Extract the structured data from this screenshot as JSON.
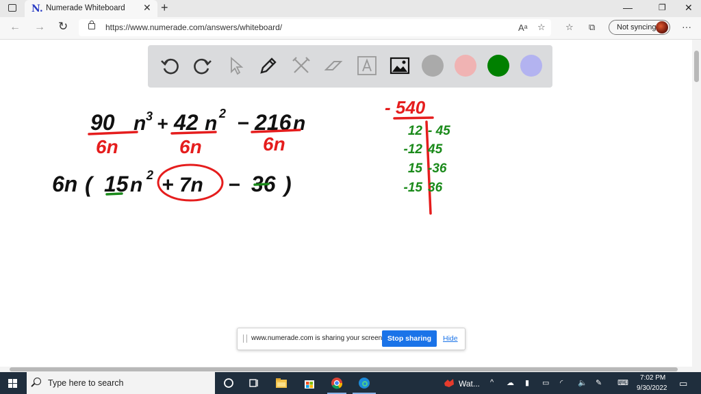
{
  "browser": {
    "tab_title": "Numerade Whiteboard",
    "tab_favicon": "N.",
    "url": "https://www.numerade.com/answers/whiteboard/",
    "sync_label": "Not syncing"
  },
  "toolbar": {
    "tools": [
      "undo-icon",
      "redo-icon",
      "pointer-icon",
      "pen-icon",
      "tools-icon",
      "eraser-icon",
      "text-icon",
      "image-icon"
    ],
    "colors": [
      "#aaaaaa",
      "#f0b3b3",
      "#008000",
      "#b3b3f0"
    ]
  },
  "whiteboard": {
    "ink_colors": {
      "black": "#111111",
      "red": "#e51d1d",
      "green": "#1a8a1a"
    },
    "row1": {
      "t1_num": "90",
      "t1_var": "n",
      "t1_exp": "3",
      "op1": "+",
      "t2_num": "42",
      "t2_var": "n",
      "t2_exp": "2",
      "op2": "−",
      "t3_num": "216",
      "t3_var": "n",
      "den": "6n"
    },
    "row2": {
      "factor": "6n",
      "open": "(",
      "a": "15",
      "var": "n",
      "exp": "2",
      "mid": "+ 7n",
      "op": "−",
      "c": "36",
      "close": ")"
    },
    "table": {
      "head": "- 540",
      "left": [
        "12",
        "-12",
        "15",
        "-15"
      ],
      "right": [
        "- 45",
        "45",
        "-36",
        "36"
      ]
    }
  },
  "share_banner": {
    "message": "www.numerade.com is sharing your screen.",
    "stop_label": "Stop sharing",
    "hide_label": "Hide"
  },
  "taskbar": {
    "search_placeholder": "Type here to search",
    "app_label": "Wat...",
    "time": "7:02 PM",
    "date": "9/30/2022"
  }
}
